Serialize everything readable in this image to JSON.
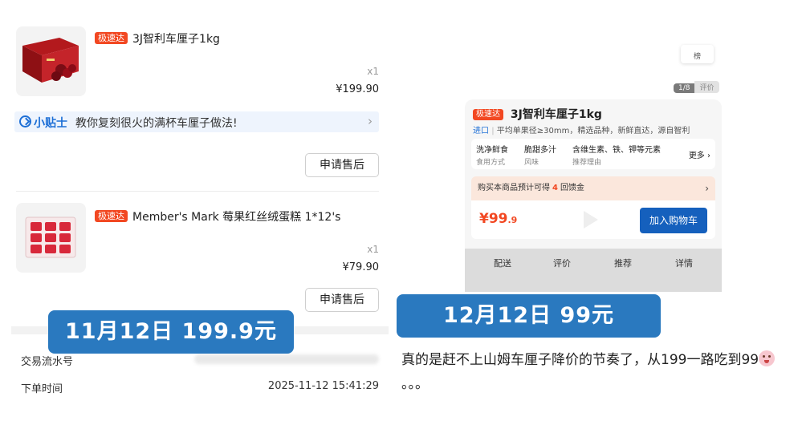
{
  "left_order": {
    "items": [
      {
        "badge": "极速达",
        "title": "3J智利车厘子1kg",
        "qty": "x1",
        "price": "¥199.90",
        "after_sale_label": "申请售后"
      },
      {
        "badge": "极速达",
        "title": "Member's Mark 莓果红丝绒蛋糕 1*12's",
        "qty": "x1",
        "price": "¥79.90",
        "after_sale_label": "申请售后"
      }
    ],
    "tip": {
      "label": "小贴士",
      "text": "教你复刻很火的满杯车厘子做法!",
      "chevron": "›"
    },
    "info": [
      {
        "label": "交易流水号",
        "value": ""
      },
      {
        "label": "下单时间",
        "value": "2025-11-12 15:41:29"
      }
    ]
  },
  "labels": {
    "left": "11月12日 199.9元",
    "right": "12月12日 99元"
  },
  "right_product": {
    "floaty_text": "榜",
    "pager": {
      "current": "1/8",
      "other": "评价"
    },
    "badge": "极速达",
    "title": "3J智利车厘子1kg",
    "origin": "进口",
    "subtitle": "平均单果径≥30mm，精选品种，新鲜直达，源自智利",
    "features": [
      {
        "title": "洗净鲜食",
        "sub": "食用方式"
      },
      {
        "title": "脆甜多汁",
        "sub": "风味"
      },
      {
        "title": "含维生素、铁、钾等元素",
        "sub": "推荐理由"
      }
    ],
    "more": "更多 ›",
    "cashback": {
      "prefix": "购买本商品预计可得",
      "amount": "4",
      "suffix": "回馈金",
      "chevron": "›"
    },
    "price_main": "¥99",
    "price_decimal": ".9",
    "add_to_cart": "加入购物车",
    "tabs": [
      "配送",
      "评价",
      "推荐",
      "详情"
    ]
  },
  "caption": {
    "line": "真的是赶不上山姆车厘子降价的节奏了，从199一路吃到99",
    "trail": "。。。"
  },
  "colors": {
    "badge_red": "#f24822",
    "label_blue": "#2a79bf",
    "cart_blue": "#1560bd",
    "tip_blue": "#1d6fd6"
  },
  "icons": [
    "cherry-product-image",
    "cake-product-image",
    "tip-check-icon",
    "chevron-right-icon",
    "play-icon",
    "crying-emoji-icon"
  ]
}
